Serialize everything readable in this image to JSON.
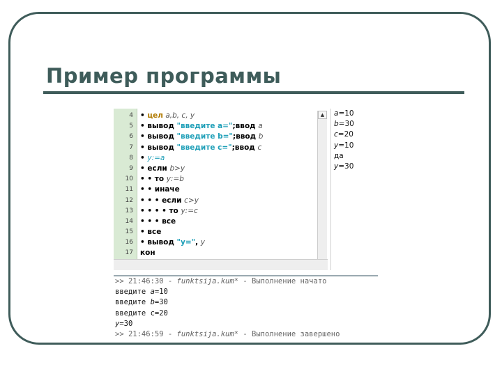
{
  "slide": {
    "title": "Пример программы"
  },
  "editor": {
    "line_numbers": [
      "4",
      "5",
      "6",
      "7",
      "8",
      "9",
      "10",
      "11",
      "12",
      "13",
      "14",
      "15",
      "16",
      "17"
    ],
    "lines": [
      [
        {
          "t": "• ",
          "c": "dot"
        },
        {
          "t": "цел",
          "c": "kwdec"
        },
        {
          "t": " a,b, c, y",
          "c": "var"
        }
      ],
      [
        {
          "t": "• ",
          "c": "dot"
        },
        {
          "t": "вывод ",
          "c": "kw"
        },
        {
          "t": "\"введите a=\"",
          "c": "str"
        },
        {
          "t": ";",
          "c": "kw"
        },
        {
          "t": "ввод ",
          "c": "kw"
        },
        {
          "t": "a",
          "c": "var"
        }
      ],
      [
        {
          "t": "• ",
          "c": "dot"
        },
        {
          "t": "вывод ",
          "c": "kw"
        },
        {
          "t": "\"введите b=\"",
          "c": "str"
        },
        {
          "t": ";",
          "c": "kw"
        },
        {
          "t": "ввод ",
          "c": "kw"
        },
        {
          "t": "b",
          "c": "var"
        }
      ],
      [
        {
          "t": "• ",
          "c": "dot"
        },
        {
          "t": "вывод ",
          "c": "kw"
        },
        {
          "t": "\"введите c=\"",
          "c": "str"
        },
        {
          "t": ";",
          "c": "kw"
        },
        {
          "t": "ввод ",
          "c": "kw"
        },
        {
          "t": "c",
          "c": "var"
        }
      ],
      [
        {
          "t": "• ",
          "c": "dot"
        },
        {
          "t": "y:=a",
          "c": "varblue"
        }
      ],
      [
        {
          "t": "• ",
          "c": "dot"
        },
        {
          "t": "если ",
          "c": "kw"
        },
        {
          "t": "b>y",
          "c": "var"
        }
      ],
      [
        {
          "t": "• • ",
          "c": "dot"
        },
        {
          "t": "то ",
          "c": "kw"
        },
        {
          "t": "y:=b",
          "c": "var"
        }
      ],
      [
        {
          "t": "• • ",
          "c": "dot"
        },
        {
          "t": "иначе",
          "c": "kw"
        }
      ],
      [
        {
          "t": "• • • ",
          "c": "dot"
        },
        {
          "t": "если ",
          "c": "kw"
        },
        {
          "t": "c>y",
          "c": "var"
        }
      ],
      [
        {
          "t": "• • • • ",
          "c": "dot"
        },
        {
          "t": "то ",
          "c": "kw"
        },
        {
          "t": "y:=c",
          "c": "var"
        }
      ],
      [
        {
          "t": "• • • ",
          "c": "dot"
        },
        {
          "t": "все",
          "c": "kw"
        }
      ],
      [
        {
          "t": "• ",
          "c": "dot"
        },
        {
          "t": "все",
          "c": "kw"
        }
      ],
      [
        {
          "t": "• ",
          "c": "dot"
        },
        {
          "t": "вывод ",
          "c": "kw"
        },
        {
          "t": "\"y=\"",
          "c": "str"
        },
        {
          "t": ", ",
          "c": "kw"
        },
        {
          "t": "y",
          "c": "var"
        }
      ],
      [
        {
          "t": "кон",
          "c": "kw"
        }
      ]
    ],
    "scroll_up": "▲",
    "scroll_down": "▼"
  },
  "output": {
    "lines": [
      [
        {
          "t": "a",
          "c": "ovar"
        },
        {
          "t": "=10",
          "c": "o"
        }
      ],
      [
        {
          "t": "b",
          "c": "ovar"
        },
        {
          "t": "=30",
          "c": "o"
        }
      ],
      [
        {
          "t": "c",
          "c": "ovar"
        },
        {
          "t": "=20",
          "c": "o"
        }
      ],
      [
        {
          "t": "y",
          "c": "ovar"
        },
        {
          "t": "=10",
          "c": "o"
        }
      ],
      [
        {
          "t": "да",
          "c": "o"
        }
      ],
      [
        {
          "t": "y",
          "c": "ovar"
        },
        {
          "t": "=30",
          "c": "o"
        }
      ]
    ]
  },
  "console": {
    "lines": [
      [
        {
          "t": ">> 21:46:30 - ",
          "c": "status"
        },
        {
          "t": "funktsija.kum*",
          "c": "file"
        },
        {
          "t": " - Выполнение начато",
          "c": "status"
        }
      ],
      [
        {
          "t": "введите ",
          "c": "n"
        },
        {
          "t": "a",
          "c": "cvar"
        },
        {
          "t": "=10",
          "c": "n"
        }
      ],
      [
        {
          "t": "введите ",
          "c": "n"
        },
        {
          "t": "b",
          "c": "cvar"
        },
        {
          "t": "=30",
          "c": "n"
        }
      ],
      [
        {
          "t": "введите c=20",
          "c": "n"
        }
      ],
      [
        {
          "t": "y",
          "c": "cvar"
        },
        {
          "t": "=30",
          "c": "n"
        }
      ],
      [
        {
          "t": ">> 21:46:59 - ",
          "c": "status"
        },
        {
          "t": "funktsija.kum*",
          "c": "file"
        },
        {
          "t": " - Выполнение завершено",
          "c": "status"
        }
      ]
    ]
  },
  "colors": {
    "frame": "#3f5c5a",
    "gutter": "#d9ead4",
    "string": "#1f9fb8",
    "decl_keyword": "#b07a00"
  }
}
